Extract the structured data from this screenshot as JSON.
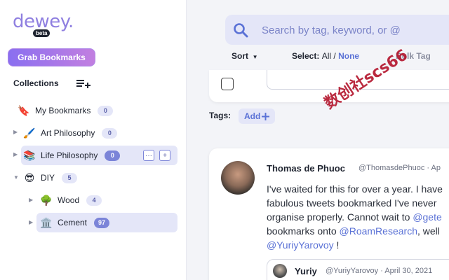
{
  "app": {
    "logo_text": "dewey.",
    "beta_label": "beta",
    "grab_button": "Grab Bookmarks"
  },
  "sidebar": {
    "collections_title": "Collections",
    "items": [
      {
        "emoji": "🔖",
        "label": "My Bookmarks",
        "count": "0"
      },
      {
        "emoji": "🖌️",
        "label": "Art Philosophy",
        "count": "0"
      },
      {
        "emoji": "📚",
        "label": "Life Philosophy",
        "count": "0",
        "menu": "···",
        "add": "+"
      },
      {
        "emoji": "😎",
        "label": "DIY",
        "count": "5"
      },
      {
        "emoji": "🌳",
        "label": "Wood",
        "count": "4"
      },
      {
        "emoji": "🏛️",
        "label": "Cement",
        "count": "97"
      }
    ]
  },
  "search": {
    "placeholder": "Search by tag, keyword, or @"
  },
  "toolbar": {
    "sort_label": "Sort",
    "select_label": "Select:",
    "select_all": "All",
    "select_sep": "/",
    "select_none": "None",
    "bulk_tag": "Bulk Tag"
  },
  "tags": {
    "label": "Tags:",
    "add_label": "Add"
  },
  "tweet": {
    "author_name": "Thomas de Phuoc",
    "author_handle": "@ThomasdePhuoc · Ap",
    "lines": [
      {
        "text": "I've waited for this for over a year. I have"
      },
      {
        "text": "fabulous tweets bookmarked I've never"
      },
      {
        "text": "organise properly. Cannot wait to ",
        "link": "@gete"
      },
      {
        "text": "bookmarks onto ",
        "link": "@RoamResearch",
        "tail": ", well"
      },
      {
        "link": "@YuriyYarovoy",
        "tail": " !"
      }
    ],
    "quote": {
      "author_name": "Yuriy",
      "author_handle": "@YuriyYarovoy · April 30, 2021"
    }
  },
  "watermark": "数创社scs66",
  "colors": {
    "accent": "#7b84d8",
    "link": "#5b72d6",
    "watermark": "#b3132b"
  }
}
